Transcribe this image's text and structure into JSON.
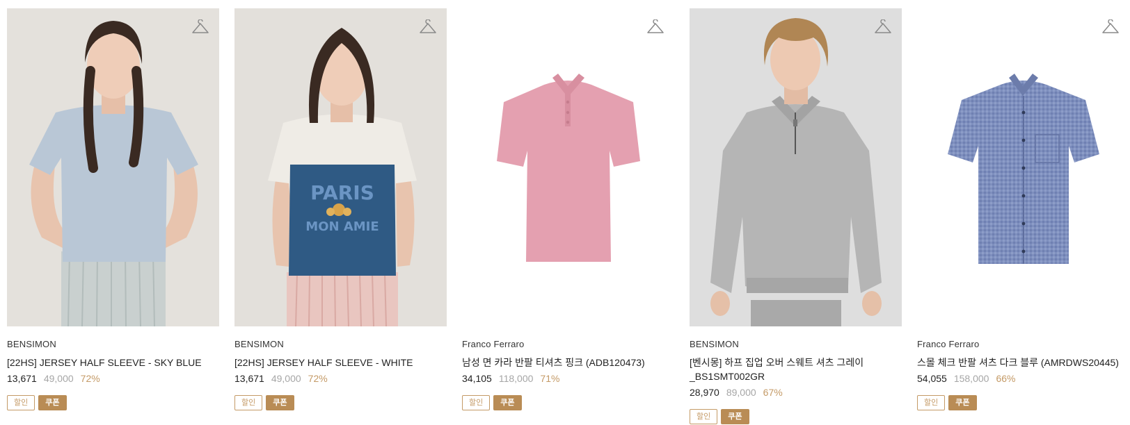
{
  "products": [
    {
      "brand": "BENSIMON",
      "name": "[22HS] JERSEY HALF SLEEVE - SKY BLUE",
      "price": "13,671",
      "original_price": "49,000",
      "discount": "72%",
      "badges": [
        "할인",
        "쿠폰"
      ],
      "image": "model-sky-blue-tee"
    },
    {
      "brand": "BENSIMON",
      "name": "[22HS] JERSEY HALF SLEEVE - WHITE",
      "price": "13,671",
      "original_price": "49,000",
      "discount": "72%",
      "badges": [
        "할인",
        "쿠폰"
      ],
      "image": "model-white-tee-navy-camisole",
      "image_text": [
        "PARIS",
        "MON AMIE"
      ]
    },
    {
      "brand": "Franco Ferraro",
      "name": "남성 면 카라 반팔 티셔츠 핑크 (ADB120473)",
      "price": "34,105",
      "original_price": "118,000",
      "discount": "71%",
      "badges": [
        "할인",
        "쿠폰"
      ],
      "image": "pink-polo-shirt"
    },
    {
      "brand": "BENSIMON",
      "name": "[벤시몽] 하프 집업 오버 스웨트 셔츠 그레이_BS1SMT002GR",
      "price": "28,970",
      "original_price": "89,000",
      "discount": "67%",
      "badges": [
        "할인",
        "쿠폰"
      ],
      "image": "model-grey-half-zip-sweatshirt"
    },
    {
      "brand": "Franco Ferraro",
      "name": "스몰 체크 반팔 셔츠 다크 블루 (AMRDWS20445)",
      "price": "54,055",
      "original_price": "158,000",
      "discount": "66%",
      "badges": [
        "할인",
        "쿠폰"
      ],
      "image": "blue-check-short-sleeve-shirt"
    }
  ],
  "icons": {
    "wishlist": "hanger-icon"
  },
  "colors": {
    "accent": "#c49a66",
    "badge_fill": "#b98c55",
    "muted": "#a6a6a6"
  }
}
